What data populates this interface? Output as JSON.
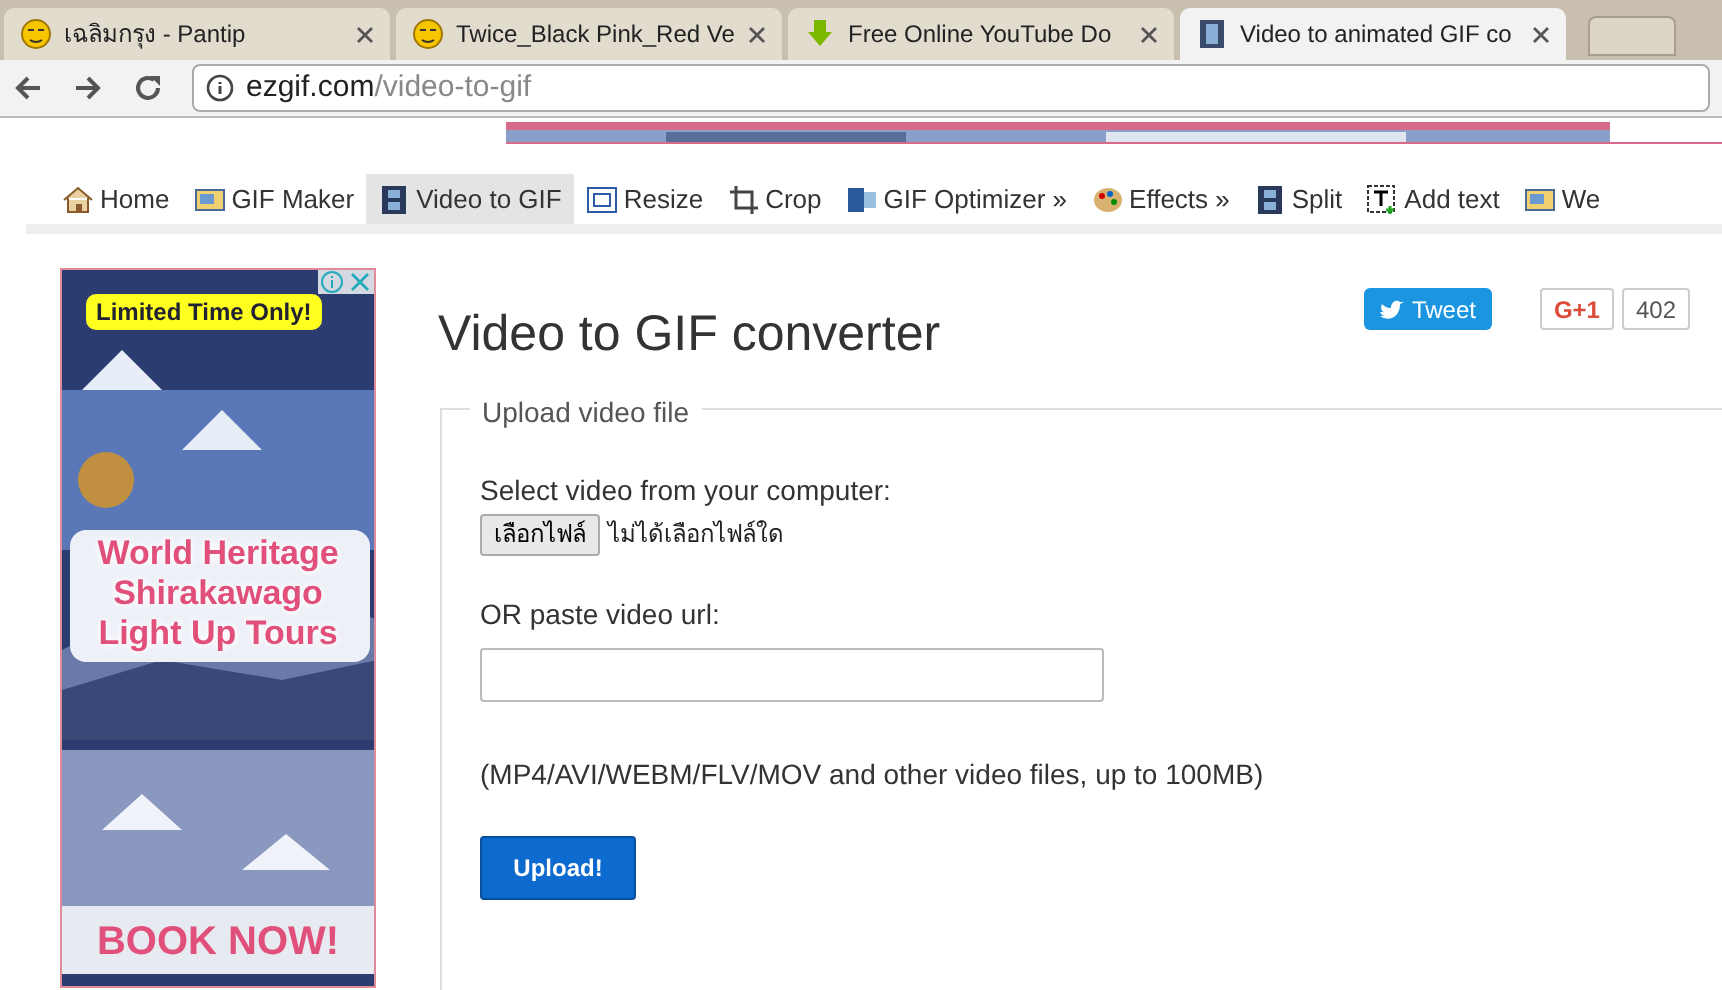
{
  "browser_tabs": [
    {
      "title": "เฉลิมกรุง - Pantip",
      "selected": false
    },
    {
      "title": "Twice_Black Pink_Red Ve",
      "selected": false
    },
    {
      "title": "Free Online YouTube Do",
      "selected": false
    },
    {
      "title": "Video to animated GIF co",
      "selected": true
    }
  ],
  "address_bar": {
    "host": "ezgif.com",
    "path": "/video-to-gif"
  },
  "nav": [
    {
      "label": "Home",
      "selected": false
    },
    {
      "label": "GIF Maker",
      "selected": false
    },
    {
      "label": "Video to GIF",
      "selected": true
    },
    {
      "label": "Resize",
      "selected": false
    },
    {
      "label": "Crop",
      "selected": false
    },
    {
      "label": "GIF Optimizer »",
      "selected": false
    },
    {
      "label": "Effects »",
      "selected": false
    },
    {
      "label": "Split",
      "selected": false
    },
    {
      "label": "Add text",
      "selected": false
    },
    {
      "label": "We",
      "selected": false
    }
  ],
  "side_ad": {
    "kind": "picture",
    "badge": "Limited Time Only!",
    "headline": [
      "World Heritage",
      "Shirakawago",
      "Light Up Tours"
    ],
    "cta": "BOOK NOW!"
  },
  "main": {
    "title": "Video to GIF converter",
    "tweet": "Tweet",
    "gplus": "G+1",
    "gplus_count": "402",
    "form": {
      "legend": "Upload video file",
      "select_label": "Select video from your computer:",
      "file_button": "เลือกไฟล์",
      "file_status": "ไม่ได้เลือกไฟล์ใด",
      "url_label": "OR paste video url:",
      "note": "(MP4/AVI/WEBM/FLV/MOV and other video files, up to 100MB)",
      "submit": "Upload!"
    }
  }
}
